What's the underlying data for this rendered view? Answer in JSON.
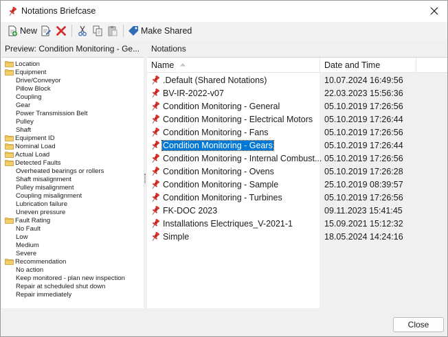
{
  "window": {
    "title": "Notations Briefcase",
    "close_glyph": "✕"
  },
  "toolbar": {
    "new_label": "New",
    "make_shared_label": "Make Shared",
    "icons": [
      "new-icon",
      "edit-icon",
      "delete-icon",
      "cut-icon",
      "copy-icon",
      "paste-icon",
      "tag-icon"
    ]
  },
  "left_panel": {
    "header": "Preview: Condition Monitoring - Ge...",
    "tree": [
      {
        "label": "Location",
        "folder": true
      },
      {
        "label": "Equipment",
        "folder": true
      },
      {
        "label": "Drive/Conveyor",
        "folder": false
      },
      {
        "label": "Pillow Block",
        "folder": false
      },
      {
        "label": "Coupling",
        "folder": false
      },
      {
        "label": "Gear",
        "folder": false
      },
      {
        "label": "Power Transmission Belt",
        "folder": false
      },
      {
        "label": "Pulley",
        "folder": false
      },
      {
        "label": "Shaft",
        "folder": false
      },
      {
        "label": "Equipment ID",
        "folder": true
      },
      {
        "label": "Nominal Load",
        "folder": true
      },
      {
        "label": "Actual Load",
        "folder": true
      },
      {
        "label": "Detected Faults",
        "folder": true
      },
      {
        "label": "Overheated bearings or rollers",
        "folder": false
      },
      {
        "label": "Shaft misalignment",
        "folder": false
      },
      {
        "label": "Pulley misalignment",
        "folder": false
      },
      {
        "label": "Coupling misalignment",
        "folder": false
      },
      {
        "label": "Lubrication failure",
        "folder": false
      },
      {
        "label": "Uneven pressure",
        "folder": false
      },
      {
        "label": "Fault Rating",
        "folder": true
      },
      {
        "label": "No Fault",
        "folder": false
      },
      {
        "label": "Low",
        "folder": false
      },
      {
        "label": "Medium",
        "folder": false
      },
      {
        "label": "Severe",
        "folder": false
      },
      {
        "label": "Recommendation",
        "folder": true
      },
      {
        "label": "No action",
        "folder": false
      },
      {
        "label": "Keep monitored - plan new inspection",
        "folder": false
      },
      {
        "label": "Repair at scheduled shut down",
        "folder": false
      },
      {
        "label": "Repair immediately",
        "folder": false
      }
    ]
  },
  "right_panel": {
    "header": "Notations",
    "columns": {
      "name": "Name",
      "date": "Date and Time"
    },
    "sort": {
      "column": "name",
      "direction": "ascending"
    },
    "rows": [
      {
        "name": ".Default (Shared Notations)",
        "date": "10.07.2024 16:49:56",
        "selected": false
      },
      {
        "name": "BV-IR-2022-v07",
        "date": "22.03.2023 15:56:36",
        "selected": false
      },
      {
        "name": "Condition Monitoring -  General",
        "date": "05.10.2019 17:26:56",
        "selected": false
      },
      {
        "name": "Condition Monitoring - Electrical Motors",
        "date": "05.10.2019 17:26:44",
        "selected": false
      },
      {
        "name": "Condition Monitoring - Fans",
        "date": "05.10.2019 17:26:56",
        "selected": false
      },
      {
        "name": "Condition Monitoring - Gears",
        "date": "05.10.2019 17:26:44",
        "selected": true
      },
      {
        "name": "Condition Monitoring - Internal Combust...",
        "date": "05.10.2019 17:26:56",
        "selected": false
      },
      {
        "name": "Condition Monitoring - Ovens",
        "date": "05.10.2019 17:26:28",
        "selected": false
      },
      {
        "name": "Condition Monitoring - Sample",
        "date": "25.10.2019 08:39:57",
        "selected": false
      },
      {
        "name": "Condition Monitoring - Turbines",
        "date": "05.10.2019 17:26:56",
        "selected": false
      },
      {
        "name": "FK-DOC 2023",
        "date": "09.11.2023 15:41:45",
        "selected": false
      },
      {
        "name": "Installations Electriques_V-2021-1",
        "date": "15.09.2021 15:12:32",
        "selected": false
      },
      {
        "name": "Simple",
        "date": "18.05.2024 14:24:16",
        "selected": false
      }
    ]
  },
  "footer": {
    "close_label": "Close"
  },
  "colors": {
    "selection": "#0078d7",
    "pin": "#d9342b",
    "folder": "#e8b84a"
  }
}
